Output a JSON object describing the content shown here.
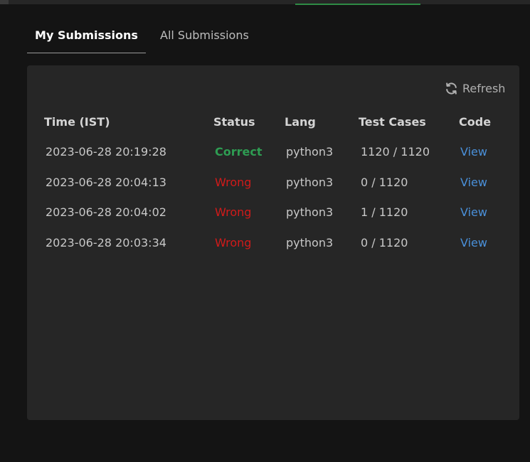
{
  "tabs": {
    "my_submissions": "My Submissions",
    "all_submissions": "All Submissions"
  },
  "toolbar": {
    "refresh_label": "Refresh",
    "refresh_icon": "refresh-icon"
  },
  "table": {
    "headers": {
      "time": "Time (IST)",
      "status": "Status",
      "lang": "Lang",
      "tests": "Test Cases",
      "code": "Code"
    },
    "rows": [
      {
        "time": "2023-06-28 20:19:28",
        "status": "Correct",
        "lang": "python3",
        "tests": "1120 / 1120",
        "code": "View"
      },
      {
        "time": "2023-06-28 20:04:13",
        "status": "Wrong",
        "lang": "python3",
        "tests": "0 / 1120",
        "code": "View"
      },
      {
        "time": "2023-06-28 20:04:02",
        "status": "Wrong",
        "lang": "python3",
        "tests": "1 / 1120",
        "code": "View"
      },
      {
        "time": "2023-06-28 20:03:34",
        "status": "Wrong",
        "lang": "python3",
        "tests": "0 / 1120",
        "code": "View"
      }
    ]
  },
  "colors": {
    "correct": "#2e9c52",
    "wrong": "#d11a1a",
    "link": "#4a90d9",
    "accent": "#2e8b45",
    "panel": "#262626",
    "background": "#141414"
  }
}
